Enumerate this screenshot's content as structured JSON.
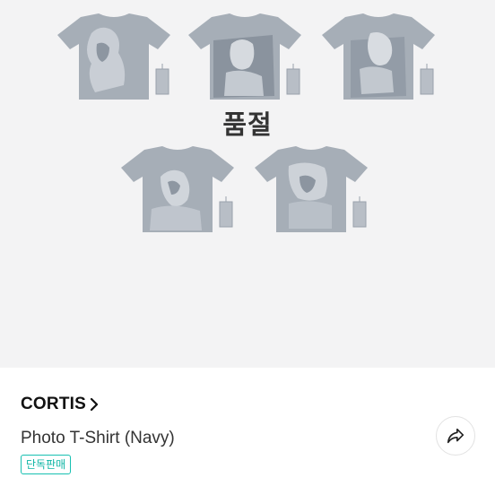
{
  "product_images": {
    "shirt_color": "#a6aeb7",
    "shirt_shadow": "#8f98a2",
    "print_color": "#d4d8dd",
    "soldout_label": "품절",
    "shirts": [
      {
        "name": "shirt-1"
      },
      {
        "name": "shirt-2"
      },
      {
        "name": "shirt-3"
      },
      {
        "name": "shirt-4"
      },
      {
        "name": "shirt-5"
      }
    ]
  },
  "product": {
    "brand": "CORTIS",
    "brand_icon": "chevron-right-icon",
    "title": "Photo T-Shirt (Navy)",
    "badge": "단독판매",
    "badge_color": "#17c0b1",
    "share_icon": "share-icon"
  }
}
